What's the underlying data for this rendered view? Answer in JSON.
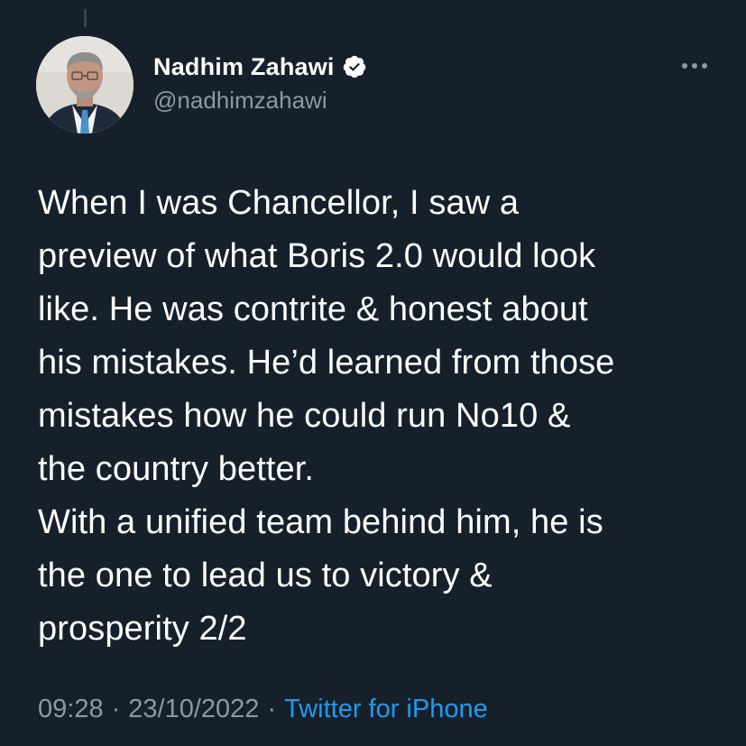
{
  "tweet": {
    "author": {
      "display_name": "Nadhim Zahawi",
      "handle": "@nadhimzahawi",
      "verified": true
    },
    "text": "When I was Chancellor, I saw a\npreview of what Boris 2.0 would look\nlike. He was contrite & honest about\nhis mistakes. He’d learned from those\nmistakes how he could run No10 &\nthe country better.\nWith a unified team behind him, he is\nthe one to lead us to victory &\nprosperity 2/2",
    "time": "09:28",
    "date": "23/10/2022",
    "separator": "·",
    "source": "Twitter for iPhone",
    "more_icon": "ellipsis-icon"
  },
  "theme": {
    "background": "#15202b",
    "text": "#ffffff",
    "secondary_text": "#8b98a5",
    "accent": "#1d9bf0"
  }
}
